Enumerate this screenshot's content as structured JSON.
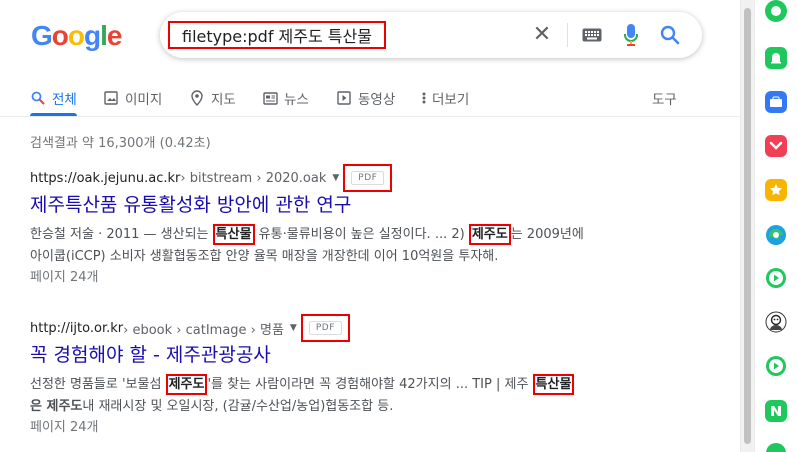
{
  "search": {
    "query": "filetype:pdf 제주도 특산물"
  },
  "tabs": [
    {
      "label": "전체",
      "icon": "search-icon",
      "active": true
    },
    {
      "label": "이미지",
      "icon": "image-icon"
    },
    {
      "label": "지도",
      "icon": "map-pin-icon"
    },
    {
      "label": "뉴스",
      "icon": "news-icon"
    },
    {
      "label": "동영상",
      "icon": "video-icon"
    },
    {
      "label": "더보기",
      "icon": "more-vert-icon"
    },
    {
      "label": "도구"
    }
  ],
  "stats": "검색결과 약 16,300개 (0.42초)",
  "results": [
    {
      "domain": "https://oak.jejunu.ac.kr",
      "path": " › bitstream › 2020.oak",
      "badge": "PDF",
      "title": "제주특산품 유통활성화 방안에 관한 연구",
      "line1_a": "한승철 저술 · 2011 — 생산되는 ",
      "line1_hl1": "특산물",
      "line1_b": " 유통·물류비용이 높은 실정이다. ... 2) ",
      "line1_hl2": "제주도",
      "line1_c": "는 2009년에",
      "line2": "아이쿱(iCCP) 소비자 생활협동조합 안양 율목 매장을 개장한데 이어 10억원을 투자해.",
      "pages": "페이지 24개"
    },
    {
      "domain": "http://ijto.or.kr",
      "path": " › ebook › catImage › 명품",
      "badge": "PDF",
      "title": "꼭 경험해야 할 - 제주관광공사",
      "line1_a": "선정한 명품들로 '보물섬 ",
      "line1_hl1": "제주도",
      "line1_b": "'를 찾는 사람이라면 꼭 경험해야할 42가지의 ... TIP | 제주 ",
      "line1_hl2": "특산물",
      "line2_bold": "은 제주도",
      "line2": "내 재래시장 및 오일시장, (감귤/수산업/농업)협동조합 등.",
      "pages": "페이지 24개"
    }
  ],
  "colors": {
    "link": "#1a0dab",
    "accent": "#1a73e8",
    "annotation": "#ee0000"
  },
  "sidebar_icons": [
    "green-circle-icon",
    "notification-bell-icon",
    "briefcase-icon",
    "pocket-icon",
    "star-icon",
    "edge-browser-icon",
    "play-circle-icon",
    "avatar-icon",
    "play-circle-icon-2",
    "naver-logo-icon"
  ]
}
